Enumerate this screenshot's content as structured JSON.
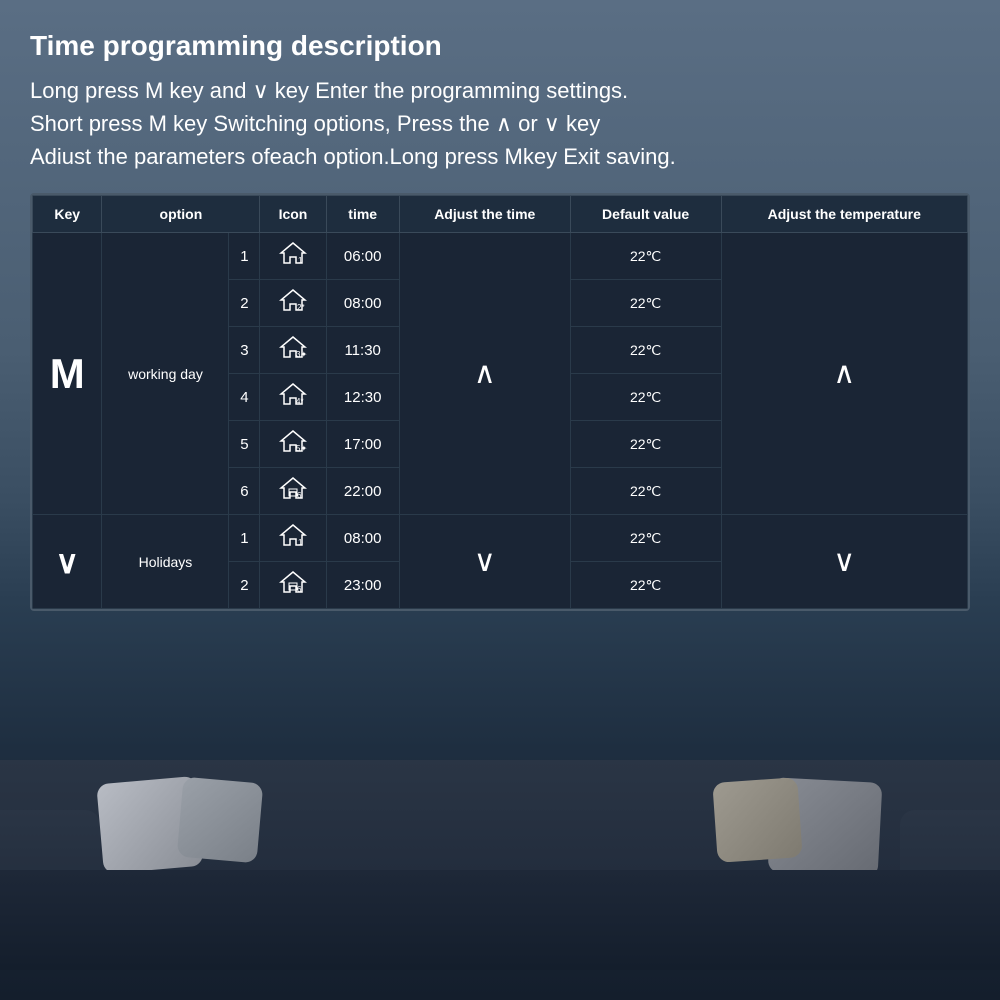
{
  "page": {
    "title": "Time programming description",
    "description_line1": "Long press M key and ∨ key Enter the programming settings.",
    "description_line2": "Short press M key Switching options, Press the ∧ or ∨ key",
    "description_line3": "Adiust the parameters ofeach option.Long press Mkey Exit saving."
  },
  "table": {
    "headers": {
      "key": "Key",
      "option": "option",
      "icon": "Icon",
      "time": "time",
      "adjust_time": "Adjust the time",
      "default_value": "Default value",
      "adjust_temp": "Adjust the temperature"
    },
    "rows": [
      {
        "key": "M",
        "option_group": "working day",
        "sub_num": "1",
        "icon": "🏠₁",
        "time": "06:00",
        "default": "22℃"
      },
      {
        "key": "",
        "option_group": "",
        "sub_num": "2",
        "icon": "🏠₂",
        "time": "08:00",
        "default": "22℃"
      },
      {
        "key": "",
        "option_group": "",
        "sub_num": "3",
        "icon": "🏠₃",
        "time": "11:30",
        "default": "22℃"
      },
      {
        "key": "",
        "option_group": "",
        "sub_num": "4",
        "icon": "🏠₄",
        "time": "12:30",
        "default": "22℃"
      },
      {
        "key": "",
        "option_group": "",
        "sub_num": "5",
        "icon": "🏠₅",
        "time": "17:00",
        "default": "22℃"
      },
      {
        "key": "",
        "option_group": "",
        "sub_num": "6",
        "icon": "🏠₆",
        "time": "22:00",
        "default": "22℃"
      },
      {
        "key": "∨",
        "option_group": "Holidays",
        "sub_num": "1",
        "icon": "🏠₁",
        "time": "08:00",
        "default": "22℃"
      },
      {
        "key": "",
        "option_group": "",
        "sub_num": "2",
        "icon": "🏠₆",
        "time": "23:00",
        "default": "22℃"
      }
    ]
  }
}
